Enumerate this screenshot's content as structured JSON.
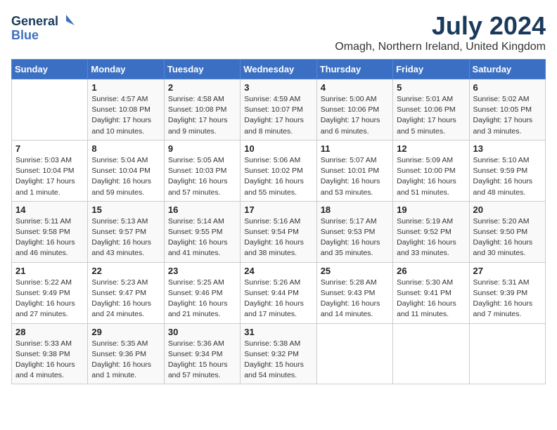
{
  "header": {
    "logo_line1": "General",
    "logo_line2": "Blue",
    "month": "July 2024",
    "location": "Omagh, Northern Ireland, United Kingdom"
  },
  "weekdays": [
    "Sunday",
    "Monday",
    "Tuesday",
    "Wednesday",
    "Thursday",
    "Friday",
    "Saturday"
  ],
  "weeks": [
    [
      {
        "day": "",
        "info": ""
      },
      {
        "day": "1",
        "info": "Sunrise: 4:57 AM\nSunset: 10:08 PM\nDaylight: 17 hours\nand 10 minutes."
      },
      {
        "day": "2",
        "info": "Sunrise: 4:58 AM\nSunset: 10:08 PM\nDaylight: 17 hours\nand 9 minutes."
      },
      {
        "day": "3",
        "info": "Sunrise: 4:59 AM\nSunset: 10:07 PM\nDaylight: 17 hours\nand 8 minutes."
      },
      {
        "day": "4",
        "info": "Sunrise: 5:00 AM\nSunset: 10:06 PM\nDaylight: 17 hours\nand 6 minutes."
      },
      {
        "day": "5",
        "info": "Sunrise: 5:01 AM\nSunset: 10:06 PM\nDaylight: 17 hours\nand 5 minutes."
      },
      {
        "day": "6",
        "info": "Sunrise: 5:02 AM\nSunset: 10:05 PM\nDaylight: 17 hours\nand 3 minutes."
      }
    ],
    [
      {
        "day": "7",
        "info": "Sunrise: 5:03 AM\nSunset: 10:04 PM\nDaylight: 17 hours\nand 1 minute."
      },
      {
        "day": "8",
        "info": "Sunrise: 5:04 AM\nSunset: 10:04 PM\nDaylight: 16 hours\nand 59 minutes."
      },
      {
        "day": "9",
        "info": "Sunrise: 5:05 AM\nSunset: 10:03 PM\nDaylight: 16 hours\nand 57 minutes."
      },
      {
        "day": "10",
        "info": "Sunrise: 5:06 AM\nSunset: 10:02 PM\nDaylight: 16 hours\nand 55 minutes."
      },
      {
        "day": "11",
        "info": "Sunrise: 5:07 AM\nSunset: 10:01 PM\nDaylight: 16 hours\nand 53 minutes."
      },
      {
        "day": "12",
        "info": "Sunrise: 5:09 AM\nSunset: 10:00 PM\nDaylight: 16 hours\nand 51 minutes."
      },
      {
        "day": "13",
        "info": "Sunrise: 5:10 AM\nSunset: 9:59 PM\nDaylight: 16 hours\nand 48 minutes."
      }
    ],
    [
      {
        "day": "14",
        "info": "Sunrise: 5:11 AM\nSunset: 9:58 PM\nDaylight: 16 hours\nand 46 minutes."
      },
      {
        "day": "15",
        "info": "Sunrise: 5:13 AM\nSunset: 9:57 PM\nDaylight: 16 hours\nand 43 minutes."
      },
      {
        "day": "16",
        "info": "Sunrise: 5:14 AM\nSunset: 9:55 PM\nDaylight: 16 hours\nand 41 minutes."
      },
      {
        "day": "17",
        "info": "Sunrise: 5:16 AM\nSunset: 9:54 PM\nDaylight: 16 hours\nand 38 minutes."
      },
      {
        "day": "18",
        "info": "Sunrise: 5:17 AM\nSunset: 9:53 PM\nDaylight: 16 hours\nand 35 minutes."
      },
      {
        "day": "19",
        "info": "Sunrise: 5:19 AM\nSunset: 9:52 PM\nDaylight: 16 hours\nand 33 minutes."
      },
      {
        "day": "20",
        "info": "Sunrise: 5:20 AM\nSunset: 9:50 PM\nDaylight: 16 hours\nand 30 minutes."
      }
    ],
    [
      {
        "day": "21",
        "info": "Sunrise: 5:22 AM\nSunset: 9:49 PM\nDaylight: 16 hours\nand 27 minutes."
      },
      {
        "day": "22",
        "info": "Sunrise: 5:23 AM\nSunset: 9:47 PM\nDaylight: 16 hours\nand 24 minutes."
      },
      {
        "day": "23",
        "info": "Sunrise: 5:25 AM\nSunset: 9:46 PM\nDaylight: 16 hours\nand 21 minutes."
      },
      {
        "day": "24",
        "info": "Sunrise: 5:26 AM\nSunset: 9:44 PM\nDaylight: 16 hours\nand 17 minutes."
      },
      {
        "day": "25",
        "info": "Sunrise: 5:28 AM\nSunset: 9:43 PM\nDaylight: 16 hours\nand 14 minutes."
      },
      {
        "day": "26",
        "info": "Sunrise: 5:30 AM\nSunset: 9:41 PM\nDaylight: 16 hours\nand 11 minutes."
      },
      {
        "day": "27",
        "info": "Sunrise: 5:31 AM\nSunset: 9:39 PM\nDaylight: 16 hours\nand 7 minutes."
      }
    ],
    [
      {
        "day": "28",
        "info": "Sunrise: 5:33 AM\nSunset: 9:38 PM\nDaylight: 16 hours\nand 4 minutes."
      },
      {
        "day": "29",
        "info": "Sunrise: 5:35 AM\nSunset: 9:36 PM\nDaylight: 16 hours\nand 1 minute."
      },
      {
        "day": "30",
        "info": "Sunrise: 5:36 AM\nSunset: 9:34 PM\nDaylight: 15 hours\nand 57 minutes."
      },
      {
        "day": "31",
        "info": "Sunrise: 5:38 AM\nSunset: 9:32 PM\nDaylight: 15 hours\nand 54 minutes."
      },
      {
        "day": "",
        "info": ""
      },
      {
        "day": "",
        "info": ""
      },
      {
        "day": "",
        "info": ""
      }
    ]
  ]
}
